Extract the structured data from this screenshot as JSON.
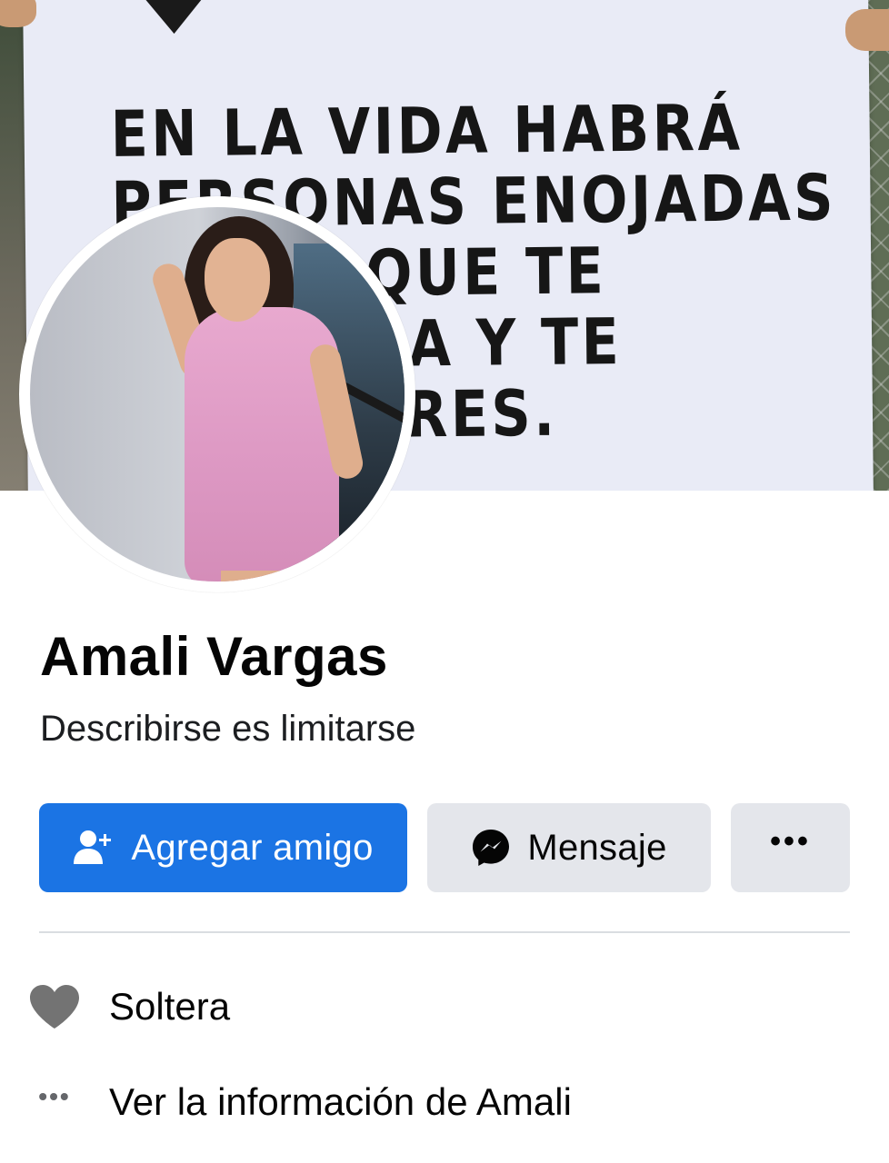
{
  "cover": {
    "sign_text": "EN LA VIDA HABRÁ\nPERSONAS ENOJADAS\nPORQUE TE\nTIERRA Y TE\nFLORES.",
    "sign_lines": [
      "EN LA VIDA HABRÁ",
      "PERSONAS ENOJADAS",
      "PORQUE TE",
      "TIERRA Y TE",
      "FLORES."
    ]
  },
  "profile": {
    "name": "Amali Vargas",
    "bio": "Describirse es limitarse"
  },
  "actions": {
    "add_friend_label": "Agregar amigo",
    "add_friend_icon": "add-friend-icon",
    "message_label": "Mensaje",
    "message_icon": "messenger-icon",
    "more_icon": "more-options-icon",
    "more_glyph": "•••"
  },
  "info": {
    "relationship": {
      "icon": "heart-icon",
      "label": "Soltera"
    },
    "about": {
      "icon": "more-dots-icon",
      "glyph": "•••",
      "label": "Ver la información de Amali"
    }
  },
  "colors": {
    "primary": "#1b74e4",
    "secondary_button": "#e4e6eb",
    "text": "#050505",
    "muted_icon": "#65676b",
    "divider": "#dadde1",
    "sign_paper": "#e9ebf6"
  }
}
